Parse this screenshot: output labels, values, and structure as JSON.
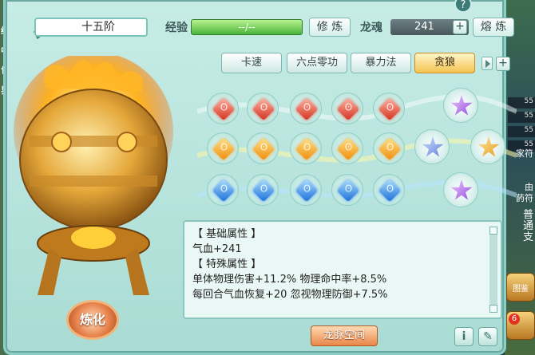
{
  "header": {
    "stage": "十五阶",
    "exp_label": "经验",
    "exp_value": "--/--",
    "cultivate_btn": "修 炼",
    "soul_label": "龙魂",
    "soul_value": "241",
    "smelt_btn": "熔 炼",
    "help": "?"
  },
  "tabs": [
    {
      "label": "卡速",
      "active": false
    },
    {
      "label": "六点零功",
      "active": false
    },
    {
      "label": "暴力法",
      "active": false
    },
    {
      "label": "贪狼",
      "active": true
    }
  ],
  "gems": {
    "rows": [
      {
        "color": "red",
        "count": 5
      },
      {
        "color": "orange",
        "count": 5
      },
      {
        "color": "blue",
        "count": 5
      }
    ]
  },
  "attributes": {
    "basic_header": "【 基础属性 】",
    "hp": "气血+241",
    "special_header": "【 特殊属性 】",
    "line1": "单体物理伤害+11.2%  物理命中率+8.5%",
    "line2": "每回合气血恢复+20  忽视物理防御+7.5%"
  },
  "actions": {
    "refine": "炼化",
    "dragon_space": "龙脉空间",
    "info": "i",
    "edit": "✎"
  },
  "left_strip": [
    "细",
    "中",
    "世",
    "界"
  ],
  "world_tags": [
    "55",
    "55",
    "55",
    "55"
  ],
  "side_icons": [
    "图鉴",
    ""
  ],
  "side_badge": "6",
  "world_glyphs": [
    "由",
    "家符",
    "菂符",
    "普",
    "通",
    "支"
  ]
}
